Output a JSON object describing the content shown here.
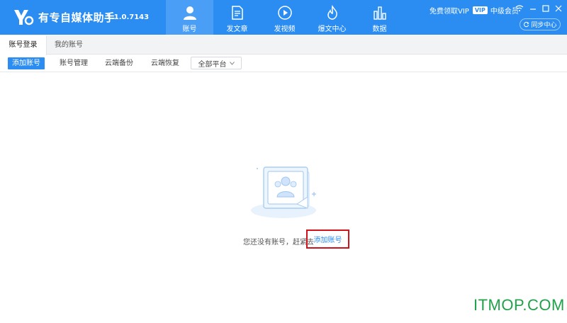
{
  "app": {
    "title": "有专自媒体助手",
    "version": "1.1.0.7143"
  },
  "nav": [
    {
      "label": "账号",
      "icon": "user-icon",
      "active": true
    },
    {
      "label": "发文章",
      "icon": "document-icon",
      "active": false
    },
    {
      "label": "发视频",
      "icon": "play-icon",
      "active": false
    },
    {
      "label": "爆文中心",
      "icon": "flame-icon",
      "active": false
    },
    {
      "label": "数据",
      "icon": "bar-chart-icon",
      "active": false
    }
  ],
  "header": {
    "vip_link": "免费领取VIP",
    "vip_badge": "VIP",
    "member_level": "中级会员",
    "sync_label": "同步中心"
  },
  "tabs": [
    {
      "label": "账号登录",
      "active": true
    },
    {
      "label": "我的账号",
      "active": false
    }
  ],
  "toolbar": {
    "add_account": "添加账号",
    "account_manage": "账号管理",
    "cloud_backup": "云端备份",
    "cloud_restore": "云端恢复",
    "platform_select": "全部平台"
  },
  "empty_state": {
    "message": "您还没有账号，赶紧去",
    "add_link": "添加账号"
  },
  "watermark": "ITMOP.COM",
  "colors": {
    "primary": "#2b8cf2",
    "highlight_border": "#d0121b",
    "watermark": "#22a04a"
  }
}
